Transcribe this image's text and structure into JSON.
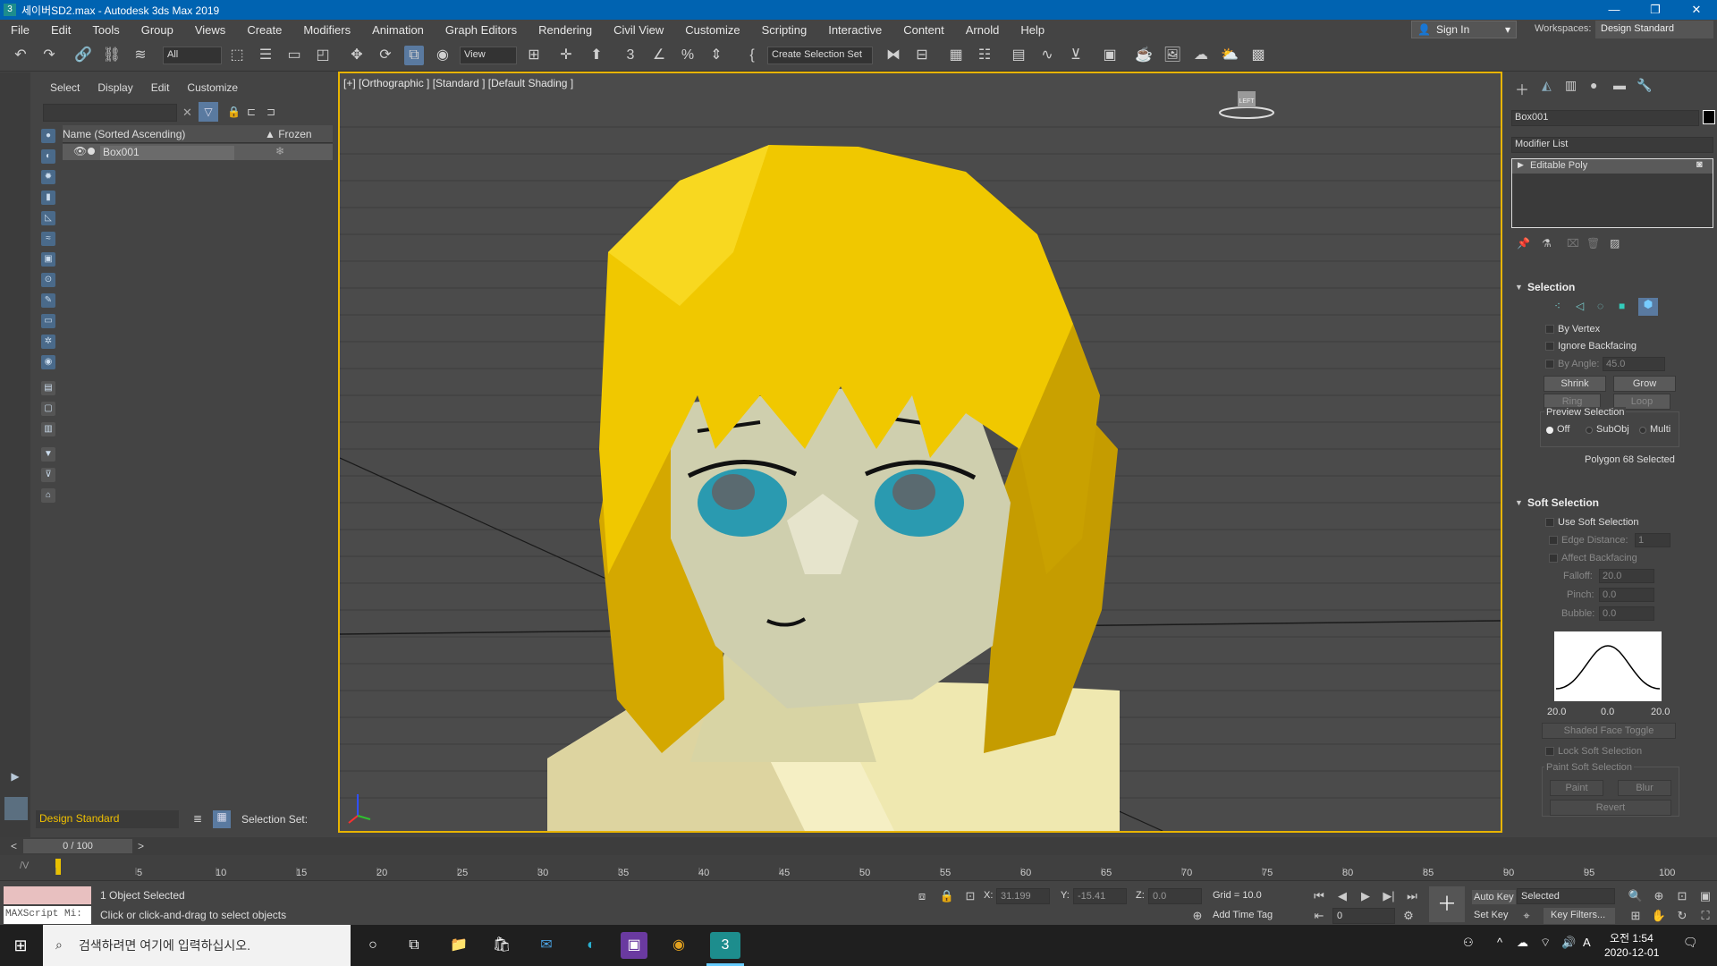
{
  "titlebar": {
    "title": "세이버SD2.max - Autodesk 3ds Max 2019",
    "min": "—",
    "restore": "❐",
    "close": "✕"
  },
  "menu": [
    "File",
    "Edit",
    "Tools",
    "Group",
    "Views",
    "Create",
    "Modifiers",
    "Animation",
    "Graph Editors",
    "Rendering",
    "Civil View",
    "Customize",
    "Scripting",
    "Interactive",
    "Content",
    "Arnold",
    "Help"
  ],
  "signin": "Sign In",
  "workspaces": {
    "label": "Workspaces:",
    "value": "Design Standard"
  },
  "toolbar": {
    "filter": "All",
    "refcoord": "View",
    "selset": "Create Selection Set"
  },
  "explorer": {
    "tabs": [
      "Select",
      "Display",
      "Edit",
      "Customize"
    ],
    "col_name": "Name (Sorted Ascending)",
    "col_frozen": "▲ Frozen",
    "rows": [
      {
        "name": "Box001"
      }
    ],
    "workspace": "Design Standard",
    "selection_set": "Selection Set:"
  },
  "viewport": {
    "label": "[+] [Orthographic ] [Standard ] [Default Shading ]",
    "cube": "LEFT"
  },
  "rightpanel": {
    "object_name": "Box001",
    "modifier_list": "Modifier List",
    "stack": [
      "Editable Poly"
    ],
    "selection": {
      "title": "Selection",
      "by_vertex": "By Vertex",
      "ignore_backfacing": "Ignore Backfacing",
      "by_angle": "By Angle:",
      "by_angle_val": "45.0",
      "shrink": "Shrink",
      "grow": "Grow",
      "ring": "Ring",
      "loop": "Loop",
      "preview": "Preview Selection",
      "off": "Off",
      "subobj": "SubObj",
      "multi": "Multi",
      "status": "Polygon 68 Selected"
    },
    "soft": {
      "title": "Soft Selection",
      "use": "Use Soft Selection",
      "edge_distance": "Edge Distance:",
      "edge_val": "1",
      "affect_backfacing": "Affect Backfacing",
      "falloff": "Falloff:",
      "falloff_val": "20.0",
      "pinch": "Pinch:",
      "pinch_val": "0.0",
      "bubble": "Bubble:",
      "bubble_val": "0.0",
      "curve_labels": [
        "20.0",
        "0.0",
        "20.0"
      ],
      "shaded": "Shaded Face Toggle",
      "lock": "Lock Soft Selection",
      "paint_group": "Paint Soft Selection",
      "paint": "Paint",
      "blur": "Blur",
      "revert": "Revert"
    }
  },
  "timeline": {
    "frame": "0 / 100",
    "ticks": [
      "5",
      "10",
      "15",
      "20",
      "25",
      "30",
      "35",
      "40",
      "45",
      "50",
      "55",
      "60",
      "65",
      "70",
      "75",
      "80",
      "85",
      "90",
      "95",
      "100"
    ]
  },
  "status": {
    "selected": "1 Object Selected",
    "prompt": "Click or click-and-drag to select objects",
    "maxscript": "MAXScript Mi:",
    "x_label": "X:",
    "x": "31.199",
    "y_label": "Y:",
    "y": "-15.41",
    "z_label": "Z:",
    "z": "0.0",
    "grid": "Grid = 10.0",
    "add_time_tag": "Add Time Tag",
    "auto_key": "Auto Key",
    "set_key": "Set Key",
    "selected_dd": "Selected",
    "key_filters": "Key Filters...",
    "frame_field": "0"
  },
  "taskbar": {
    "search": "검색하려면 여기에 입력하십시오.",
    "time": "오전 1:54",
    "date": "2020-12-01",
    "ime": "A"
  },
  "colors": {
    "accent": "#0063b1",
    "viewport_border": "#e8b400",
    "hair": "#f0c800"
  }
}
